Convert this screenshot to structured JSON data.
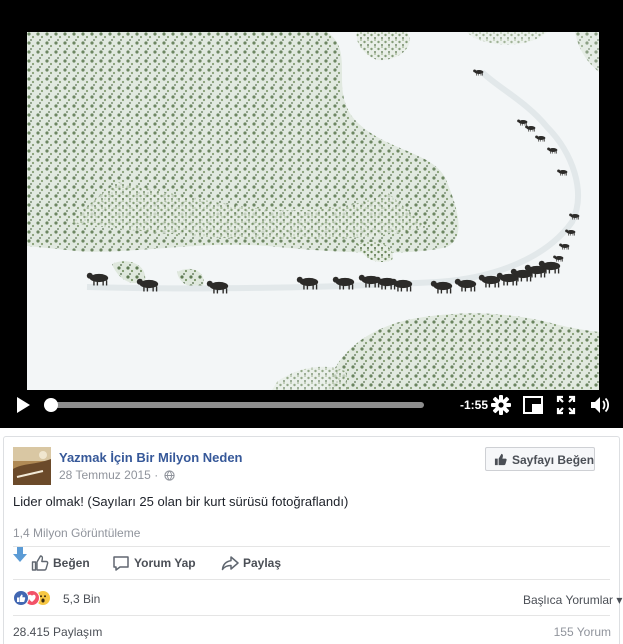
{
  "video": {
    "time_remaining": "-1:55",
    "progress": 0,
    "scene": "aerial-snowfield-wolf-pack-single-file"
  },
  "post": {
    "page_name": "Yazmak İçin Bir Milyon Neden",
    "date": "28 Temmuz 2015",
    "meta_separator": "·",
    "like_page_label": "Sayfayı Beğen",
    "text": "Lider olmak! (Sayıları 25 olan bir kurt sürüsü fotoğraflandı)",
    "views": "1,4 Milyon Görüntüleme"
  },
  "actions": {
    "like": "Beğen",
    "comment": "Yorum Yap",
    "share": "Paylaş"
  },
  "reactions": {
    "count": "5,3 Bin",
    "types": [
      "like-icon",
      "love-icon",
      "wow-icon"
    ]
  },
  "sort": {
    "label": "Başlıca Yorumlar",
    "arrow": "▾"
  },
  "footer": {
    "shares": "28.415 Paylaşım",
    "comments": "155 Yorum"
  },
  "colors": {
    "link": "#365899",
    "like_blue": "#4267b2",
    "love_red": "#f25268",
    "wow_yellow": "#f7c744",
    "save_arrow": "#5b9bd5",
    "muted": "#90949c"
  }
}
